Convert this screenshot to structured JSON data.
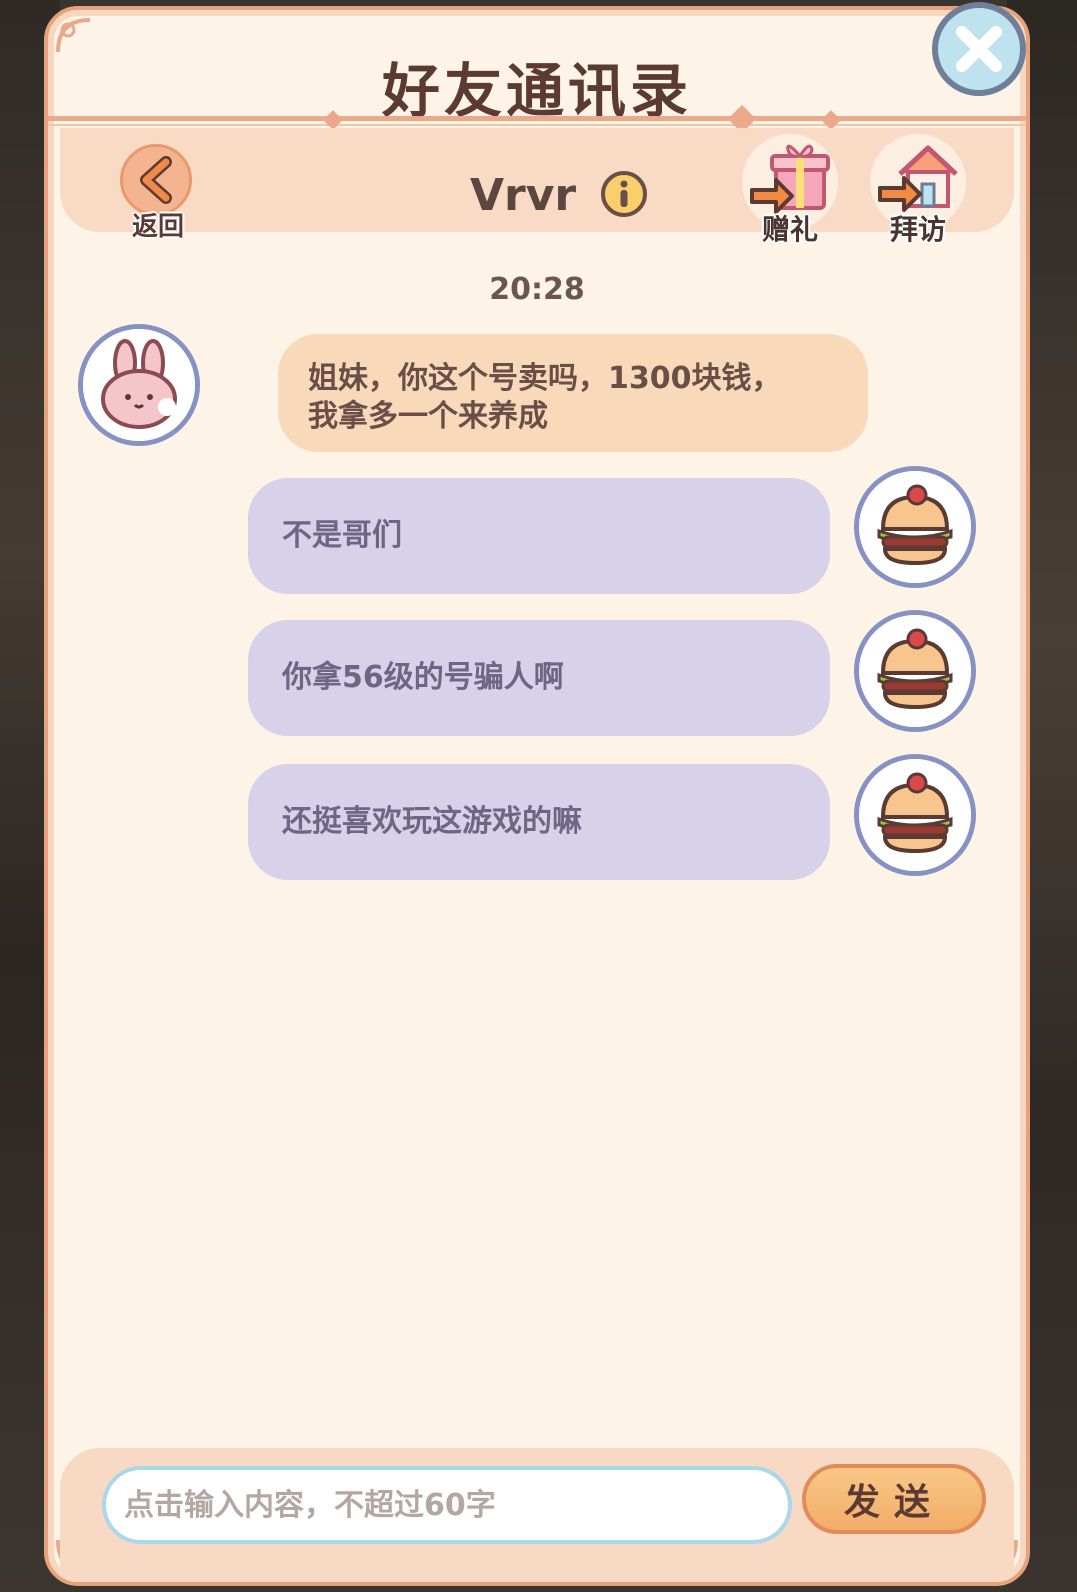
{
  "window": {
    "title": "好友通讯录"
  },
  "header": {
    "back_label": "返回",
    "friend_name": "Vrvr",
    "gift_label": "赠礼",
    "visit_label": "拜访"
  },
  "chat": {
    "timestamp": "20:28",
    "messages": [
      {
        "side": "left",
        "avatar": "bunny-avatar-icon",
        "lines": [
          "姐妹，你这个号卖吗，1300块钱，",
          "我拿多一个来养成"
        ]
      },
      {
        "side": "right",
        "avatar": "burger-avatar-icon",
        "text": "不是哥们"
      },
      {
        "side": "right",
        "avatar": "burger-avatar-icon",
        "text": "你拿56级的号骗人啊"
      },
      {
        "side": "right",
        "avatar": "burger-avatar-icon",
        "text": "还挺喜欢玩这游戏的嘛"
      }
    ]
  },
  "composer": {
    "placeholder": "点击输入内容，不超过60字",
    "send_label": "发送"
  },
  "colors": {
    "panel_bg": "#fdf3e6",
    "panel_border": "#e7a27b",
    "incoming_bubble": "#f8d9ba",
    "outgoing_bubble": "#d7d1ea",
    "send_button": "#f2ad68",
    "close_button": "#bfe3ee"
  },
  "icons": [
    "back-arrow-icon",
    "info-icon",
    "gift-icon",
    "house-icon",
    "close-icon",
    "bunny-avatar-icon",
    "burger-avatar-icon"
  ]
}
